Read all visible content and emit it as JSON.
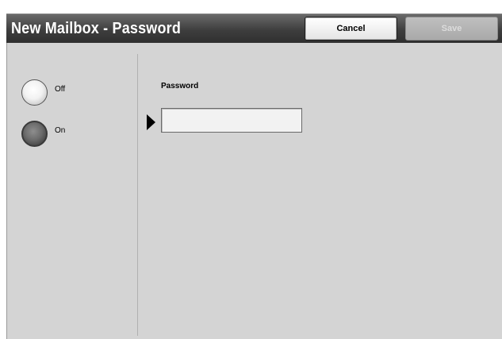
{
  "header": {
    "title": "New Mailbox - Password",
    "cancel_label": "Cancel",
    "save_label": "Save"
  },
  "password_mode": {
    "options": [
      {
        "label": "Off",
        "selected": false
      },
      {
        "label": "On",
        "selected": true
      }
    ]
  },
  "password_field": {
    "label": "Password",
    "value": "",
    "placeholder": ""
  },
  "colors": {
    "titlebar": "#3e3e3e",
    "panel_background": "#d4d4d4",
    "save_disabled": "#a9a9a9"
  },
  "icons": {
    "current_field_indicator": "triangle-right-icon"
  }
}
